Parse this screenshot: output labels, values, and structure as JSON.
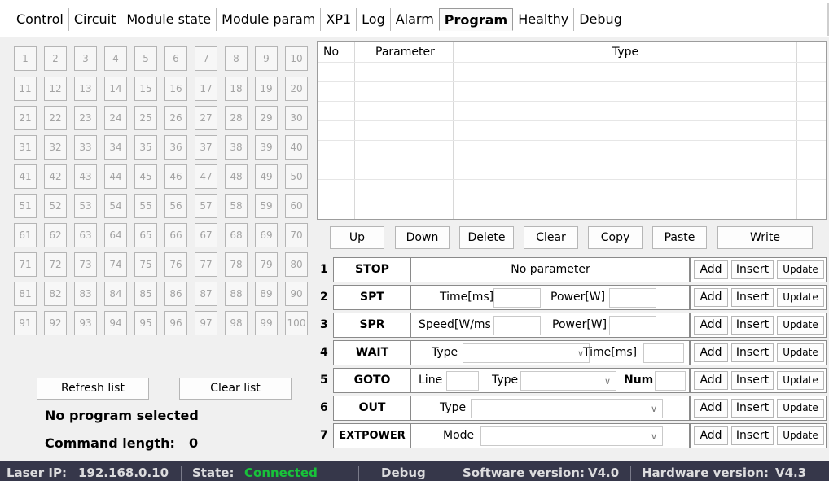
{
  "tabs": [
    "Control",
    "Circuit",
    "Module state",
    "Module param",
    "XP1",
    "Log",
    "Alarm",
    "Program",
    "Healthy",
    "Debug"
  ],
  "active_tab": "Program",
  "grid_cells": [
    "1",
    "2",
    "3",
    "4",
    "5",
    "6",
    "7",
    "8",
    "9",
    "10",
    "11",
    "12",
    "13",
    "14",
    "15",
    "16",
    "17",
    "18",
    "19",
    "20",
    "21",
    "22",
    "23",
    "24",
    "25",
    "26",
    "27",
    "28",
    "29",
    "30",
    "31",
    "32",
    "33",
    "34",
    "35",
    "36",
    "37",
    "38",
    "39",
    "40",
    "41",
    "42",
    "43",
    "44",
    "45",
    "46",
    "47",
    "48",
    "49",
    "50",
    "51",
    "52",
    "53",
    "54",
    "55",
    "56",
    "57",
    "58",
    "59",
    "60",
    "61",
    "62",
    "63",
    "64",
    "65",
    "66",
    "67",
    "68",
    "69",
    "70",
    "71",
    "72",
    "73",
    "74",
    "75",
    "76",
    "77",
    "78",
    "79",
    "80",
    "81",
    "82",
    "83",
    "84",
    "85",
    "86",
    "87",
    "88",
    "89",
    "90",
    "91",
    "92",
    "93",
    "94",
    "95",
    "96",
    "97",
    "98",
    "99",
    "100"
  ],
  "left_buttons": {
    "refresh": "Refresh list",
    "clear": "Clear list"
  },
  "program_status": "No program selected",
  "command_length": {
    "label": "Command length:",
    "value": "0"
  },
  "table": {
    "col_no": "No",
    "col_parameter": "Parameter",
    "col_type": "Type"
  },
  "actions": {
    "up": "Up",
    "down": "Down",
    "delete": "Delete",
    "clear": "Clear",
    "copy": "Copy",
    "paste": "Paste",
    "write": "Write"
  },
  "row_buttons": {
    "add": "Add",
    "insert": "Insert",
    "update": "Update"
  },
  "commands": [
    {
      "num": "1",
      "name": "STOP",
      "note": "No parameter"
    },
    {
      "num": "2",
      "name": "SPT",
      "p1": "Time[ms]",
      "p2": "Power[W]"
    },
    {
      "num": "3",
      "name": "SPR",
      "p1": "Speed[W/ms",
      "p2": "Power[W]"
    },
    {
      "num": "4",
      "name": "WAIT",
      "p1": "Type",
      "p2": "Time[ms]"
    },
    {
      "num": "5",
      "name": "GOTO",
      "p1": "Line",
      "p2": "Type",
      "p3": "Num"
    },
    {
      "num": "6",
      "name": "OUT",
      "p1": "Type"
    },
    {
      "num": "7",
      "name": "EXTPOWER",
      "p1": "Mode"
    }
  ],
  "statusbar": {
    "ip_label": "Laser IP:",
    "ip": "192.168.0.10",
    "state_label": "State:",
    "state": "Connected",
    "mode": "Debug",
    "sw_label": "Software version:",
    "sw": "V4.0",
    "hw_label": "Hardware version:",
    "hw": "V4.3"
  },
  "colors": {
    "connected": "#18c23a",
    "statusbar_bg": "#36374a"
  },
  "icons": {
    "dropdown": "chevron-down-icon"
  }
}
